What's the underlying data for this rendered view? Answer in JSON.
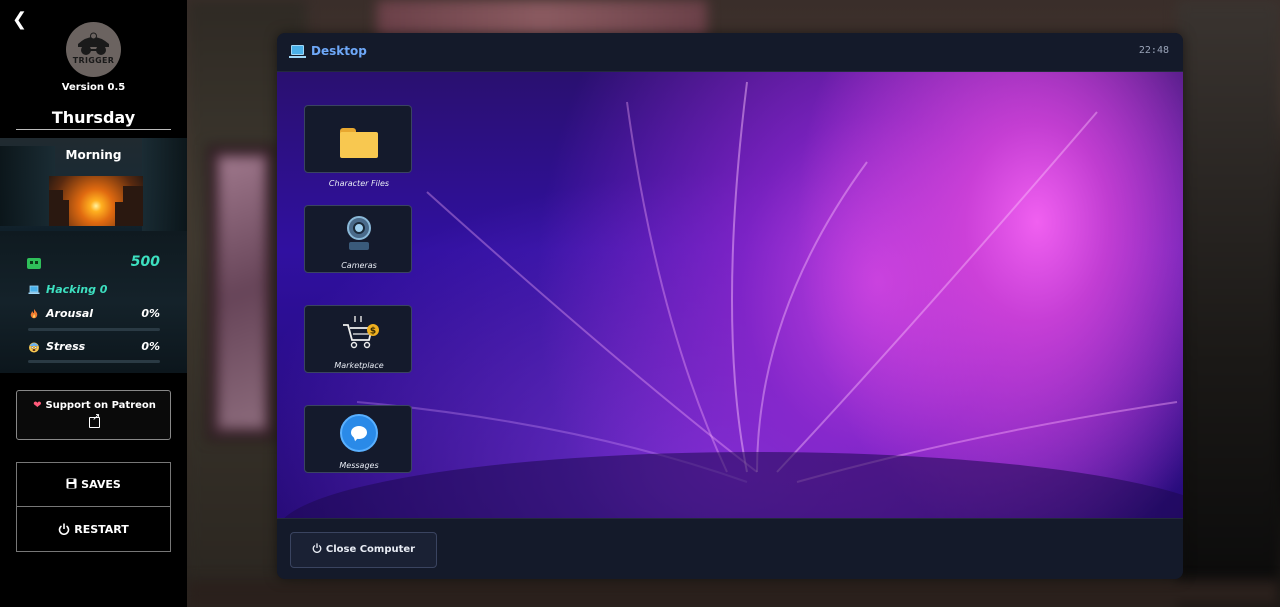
{
  "sidebar": {
    "back_icon": "chevron-left-icon",
    "logo_text": "TRIGGER",
    "version": "Version 0.5",
    "day": "Thursday",
    "time_of_day": "Morning",
    "money": "500",
    "stats": {
      "hacking": {
        "label": "Hacking 0",
        "icon": "laptop-icon"
      },
      "arousal": {
        "label": "Arousal",
        "value": "0%",
        "icon": "flame-icon",
        "level": 0
      },
      "stress": {
        "label": "Stress",
        "value": "0%",
        "icon": "stressed-face-icon",
        "level": 0
      }
    },
    "patreon_label": "Support on Patreon",
    "saves_label": "SAVES",
    "restart_label": "RESTART"
  },
  "window": {
    "title": "Desktop",
    "clock": "22:48",
    "icons": [
      {
        "label": "Character Files",
        "icon": "folder-icon"
      },
      {
        "label": "Cameras",
        "icon": "webcam-icon"
      },
      {
        "label": "Marketplace",
        "icon": "shopping-cart-icon"
      },
      {
        "label": "Messages",
        "icon": "chat-bubble-icon"
      }
    ],
    "close_label": "Close Computer"
  },
  "colors": {
    "accent_teal": "#3de0c0",
    "title_blue": "#6ea8f8",
    "heart_pink": "#ff5a7a"
  }
}
